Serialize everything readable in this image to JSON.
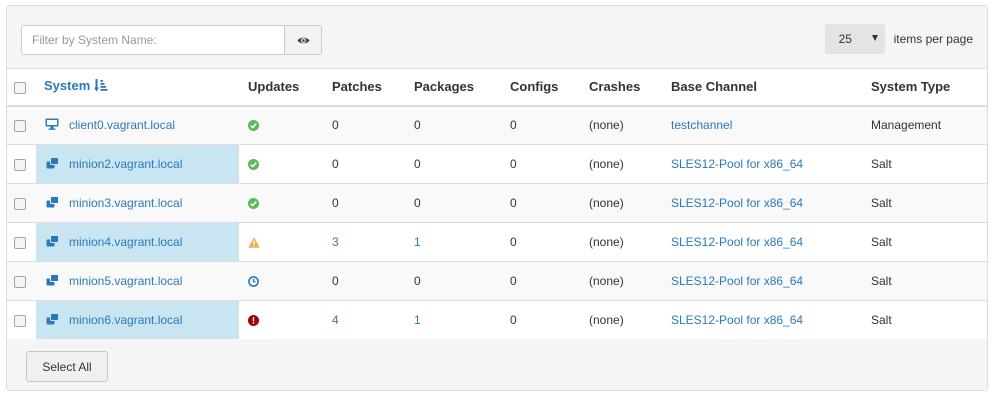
{
  "filter": {
    "placeholder": "Filter by System Name:",
    "value": ""
  },
  "pagination": {
    "per_page": "25",
    "per_page_label": "items per page"
  },
  "columns": {
    "system": "System",
    "updates": "Updates",
    "patches": "Patches",
    "packages": "Packages",
    "configs": "Configs",
    "crashes": "Crashes",
    "base_channel": "Base Channel",
    "system_type": "System Type"
  },
  "colors": {
    "link": "#2a7ab9",
    "ok": "#5cb85c",
    "warning": "#f0ad4e",
    "pending": "#2a7ab9",
    "critical": "#a40000",
    "highlight": "#c9e5f2"
  },
  "rows": [
    {
      "name": "client0.vagrant.local",
      "icon": "desktop-icon",
      "updates": "ok-icon",
      "patches": "0",
      "packages": "0",
      "configs": "0",
      "crashes": "(none)",
      "base_channel": "testchannel",
      "system_type": "Management"
    },
    {
      "name": "minion2.vagrant.local",
      "icon": "salt-minion-icon",
      "updates": "ok-icon",
      "patches": "0",
      "packages": "0",
      "configs": "0",
      "crashes": "(none)",
      "base_channel": "SLES12-Pool for x86_64",
      "system_type": "Salt"
    },
    {
      "name": "minion3.vagrant.local",
      "icon": "salt-minion-icon",
      "updates": "ok-icon",
      "patches": "0",
      "packages": "0",
      "configs": "0",
      "crashes": "(none)",
      "base_channel": "SLES12-Pool for x86_64",
      "system_type": "Salt"
    },
    {
      "name": "minion4.vagrant.local",
      "icon": "salt-minion-icon",
      "updates": "warning-icon",
      "patches": "3",
      "packages": "1",
      "configs": "0",
      "crashes": "(none)",
      "base_channel": "SLES12-Pool for x86_64",
      "system_type": "Salt"
    },
    {
      "name": "minion5.vagrant.local",
      "icon": "salt-minion-icon",
      "updates": "clock-icon",
      "patches": "0",
      "packages": "0",
      "configs": "0",
      "crashes": "(none)",
      "base_channel": "SLES12-Pool for x86_64",
      "system_type": "Salt"
    },
    {
      "name": "minion6.vagrant.local",
      "icon": "salt-minion-icon",
      "updates": "critical-icon",
      "patches": "4",
      "packages": "1",
      "configs": "0",
      "crashes": "(none)",
      "base_channel": "SLES12-Pool for x86_64",
      "system_type": "Salt"
    }
  ],
  "footer": {
    "select_all": "Select All"
  }
}
